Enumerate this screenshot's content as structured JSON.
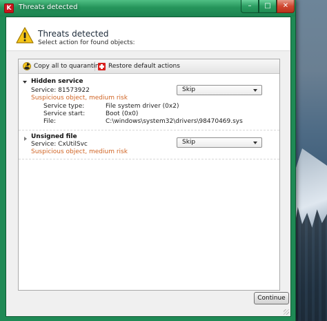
{
  "window": {
    "title": "Threats detected",
    "app_icon_letter": "K",
    "controls": {
      "minimize": "–",
      "maximize": "□",
      "close": "✕"
    }
  },
  "header": {
    "title": "Threats detected",
    "subtitle": "Select action for found objects:",
    "icon": "warning-icon"
  },
  "toolbar": {
    "copy_label": "Copy all to quarantine",
    "copy_icon": "radiation-icon",
    "restore_label": "Restore default actions",
    "restore_icon": "red-cross-icon"
  },
  "threats": [
    {
      "title": "Hidden service",
      "expanded": true,
      "service_line": "Service: 81573922",
      "risk": "Suspicious object, medium risk",
      "action": "Skip",
      "details": [
        {
          "label": "Service type:",
          "value": "File system driver (0x2)"
        },
        {
          "label": "Service start:",
          "value": "Boot (0x0)"
        },
        {
          "label": "File:",
          "value": "C:\\windows\\system32\\drivers\\98470469.sys"
        }
      ]
    },
    {
      "title": "Unsigned file",
      "expanded": false,
      "service_line": "Service: CxUtilSvc",
      "risk": "Suspicious object, medium risk",
      "action": "Skip"
    }
  ],
  "footer": {
    "continue_label": "Continue"
  },
  "colors": {
    "window_frame": "#1f8a55",
    "risk_text": "#d06424",
    "close_button": "#d0472f"
  }
}
